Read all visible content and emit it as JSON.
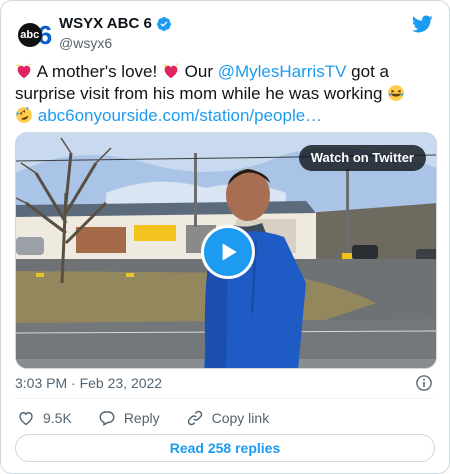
{
  "author": {
    "display_name": "WSYX ABC 6",
    "handle": "@wsyx6",
    "avatar_text_left": "abc",
    "avatar_text_right": "6"
  },
  "tweet": {
    "text_part1": " A mother's love! ",
    "text_part2": " Our ",
    "mention": "@MylesHarrisTV",
    "text_part3": " got a surprise visit from his mom while he was working ",
    "link": "abc6onyourside.com/station/people…"
  },
  "media": {
    "watch_label": "Watch on Twitter",
    "play_icon": "play-icon"
  },
  "meta": {
    "timestamp": "3:03 PM · Feb 23, 2022"
  },
  "actions": {
    "likes": "9.5K",
    "reply_label": "Reply",
    "copy_label": "Copy link"
  },
  "replies_button": "Read 258 replies",
  "colors": {
    "accent": "#1d9bf0",
    "heart": "#e0245e",
    "text_secondary": "#536471"
  }
}
